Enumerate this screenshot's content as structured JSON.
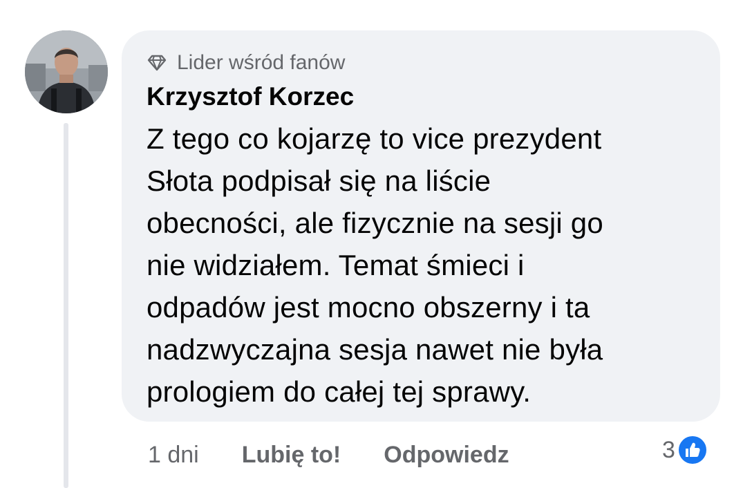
{
  "comment": {
    "badge": {
      "icon": "diamond-icon",
      "label": "Lider wśród fanów"
    },
    "author": "Krzysztof Korzec",
    "text_lines": [
      "Z tego co kojarzę to vice prezydent",
      "Słota podpisał się na liście",
      "obecności, ale fizycznie na sesji go",
      "nie widziałem. Temat śmieci i",
      "odpadów jest mocno obszerny i ta",
      "nadzwyczajna sesja nawet nie była",
      "prologiem do całej tej sprawy."
    ],
    "time": "1 dni",
    "like_label": "Lubię to!",
    "reply_label": "Odpowiedz",
    "reaction_count": "3",
    "reaction_icon": "like-thumb-icon"
  },
  "colors": {
    "bubble_bg": "#f0f2f5",
    "secondary_text": "#65676b",
    "like_blue": "#1877f2"
  }
}
